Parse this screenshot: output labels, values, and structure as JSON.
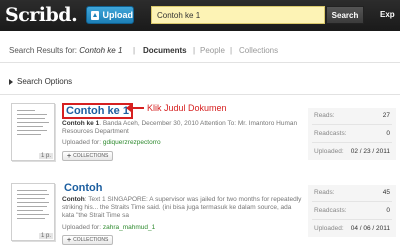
{
  "header": {
    "logo": "Scribd.",
    "upload_label": "Upload",
    "search_value": "Contoh ke 1",
    "search_button": "Search",
    "explore_label": "Exp"
  },
  "results": {
    "prefix": "Search Results for:",
    "query": "Contoh ke 1",
    "tabs": [
      "Documents",
      "People",
      "Collections"
    ],
    "search_options": "Search Options"
  },
  "annotation": "Klik Judul Dokumen",
  "colors": {
    "accent": "#1d5fa0",
    "annotation": "#d62020",
    "search_bg": "#fdf3b5"
  },
  "items": [
    {
      "title": "Contoh ke 1",
      "snippet_bold": "Contoh ke 1",
      "snippet": ". Banda Aceh, December 30, 2010 Attention To: Mr. Imantoro Human Resources Department",
      "uploaded_prefix": "Uploaded for:",
      "uploader": "gdiquerzrezpectorro",
      "collections_label": "COLLECTIONS",
      "pages": "1 p.",
      "reads_label": "Reads:",
      "reads": "27",
      "readcasts_label": "Readcasts:",
      "readcasts": "0",
      "uploaded_label": "Uploaded:",
      "uploaded": "02 / 23 / 2011"
    },
    {
      "title": "Contoh",
      "snippet_bold": "Contoh",
      "snippet": ": Text 1 SINGAPORE: A supervisor was jailed for two months for repeatedly striking his... the Straits Time said. (ini bisa juga termasuk ke dalam source, ada kata \"the Strait Time sa",
      "uploaded_prefix": "Uploaded for:",
      "uploader": "zahra_mahmud_1",
      "collections_label": "COLLECTIONS",
      "pages": "1 p.",
      "reads_label": "Reads:",
      "reads": "45",
      "readcasts_label": "Readcasts:",
      "readcasts": "0",
      "uploaded_label": "Uploaded:",
      "uploaded": "04 / 06 / 2011"
    }
  ]
}
